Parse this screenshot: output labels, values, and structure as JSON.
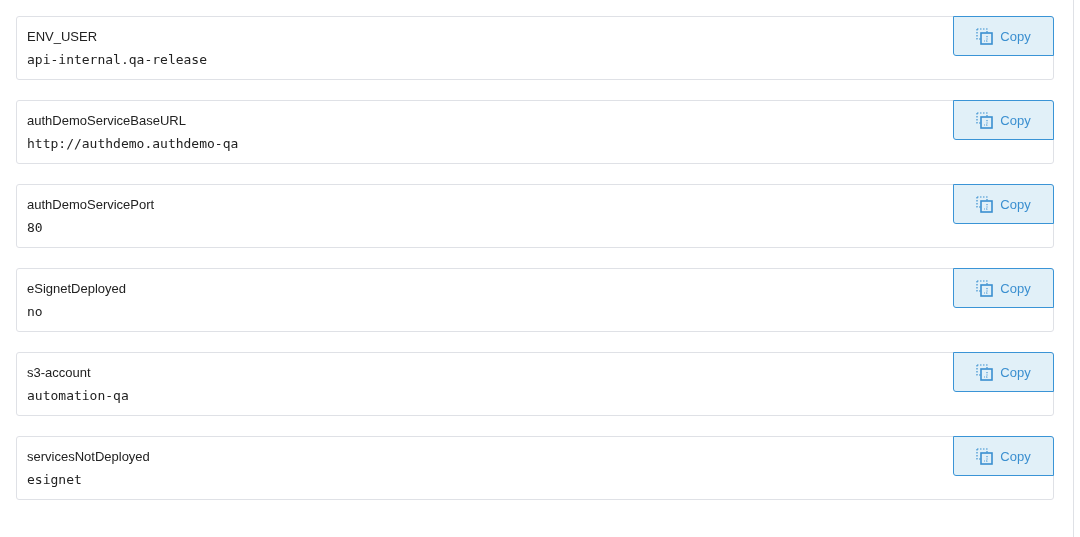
{
  "variables": [
    {
      "name": "ENV_USER",
      "value": "api-internal.qa-release",
      "button": "Copy"
    },
    {
      "name": "authDemoServiceBaseURL",
      "value": "http://authdemo.authdemo-qa",
      "button": "Copy"
    },
    {
      "name": "authDemoServicePort",
      "value": "80",
      "button": "Copy"
    },
    {
      "name": "eSignetDeployed",
      "value": "no",
      "button": "Copy"
    },
    {
      "name": "s3-account",
      "value": "automation-qa",
      "button": "Copy"
    },
    {
      "name": "servicesNotDeployed",
      "value": "esignet",
      "button": "Copy"
    }
  ]
}
